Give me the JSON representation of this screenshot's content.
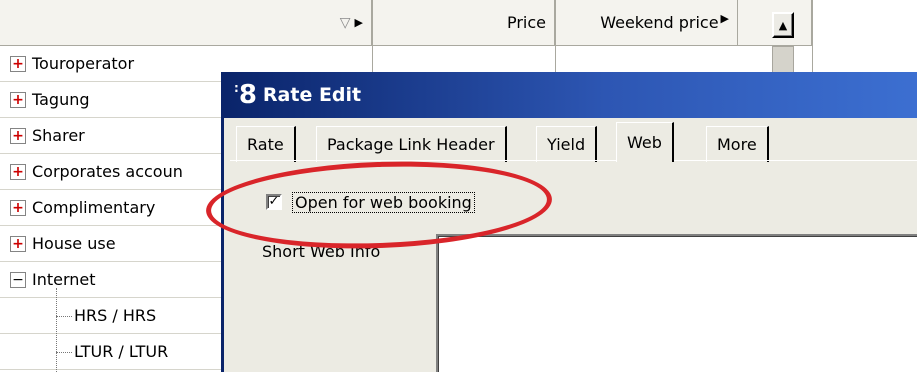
{
  "grid": {
    "columns": {
      "name_sort_glyph": "▽",
      "price": "Price",
      "weekend_price": "Weekend price"
    },
    "rows": [
      {
        "label": "Touroperator",
        "expander": "+"
      },
      {
        "label": "Tagung",
        "expander": "+"
      },
      {
        "label": "Sharer",
        "expander": "+"
      },
      {
        "label": "Corporates accoun",
        "expander": "+"
      },
      {
        "label": "Complimentary",
        "expander": "+"
      },
      {
        "label": "House use",
        "expander": "+"
      },
      {
        "label": "Internet",
        "expander": "−"
      }
    ],
    "children": [
      {
        "label": "HRS / HRS"
      },
      {
        "label": "LTUR / LTUR"
      }
    ]
  },
  "window": {
    "title": "Rate Edit",
    "icon_char": "8",
    "tabs": [
      "Rate",
      "Package Link Header",
      "Yield",
      "Web",
      "More"
    ],
    "active_tab": "Web",
    "web": {
      "open_for_web_booking_label": "Open for web booking",
      "open_for_web_booking_checked": true,
      "short_web_info_label": "Short Web Info",
      "short_web_info_value": ""
    }
  },
  "annotation": {
    "highlight_color": "#d9252a"
  },
  "colors": {
    "titlebar_start": "#0a246a",
    "titlebar_end": "#3c6fd1",
    "expander_plus": "#cc0000"
  }
}
